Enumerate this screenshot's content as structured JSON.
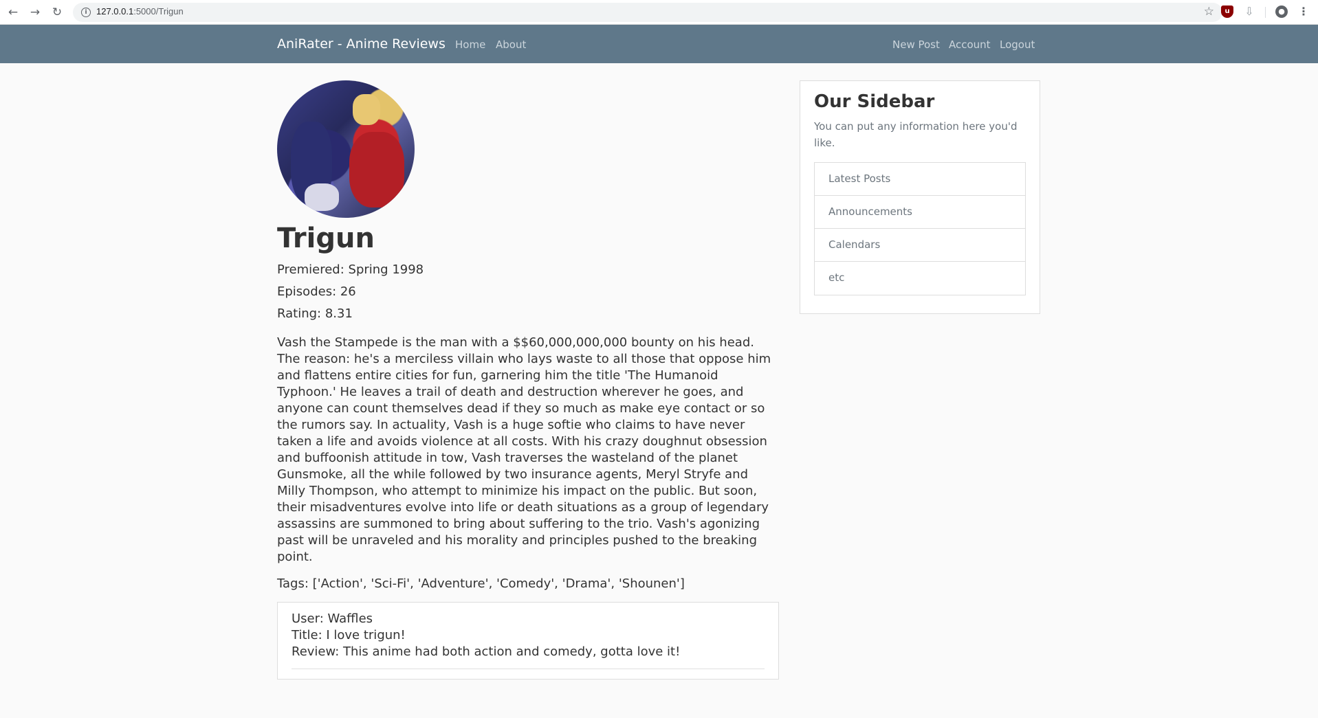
{
  "browser": {
    "url_host": "127.0.0.1",
    "url_rest": ":5000/Trigun",
    "back_icon": "←",
    "forward_icon": "→",
    "reload_icon": "↻",
    "info_icon": "i",
    "star_icon": "☆",
    "extension_icon": "u",
    "download_icon": "⇩",
    "account_icon": "●",
    "menu_icon": "⋮"
  },
  "navbar": {
    "brand": "AniRater - Anime Reviews",
    "left_links": [
      "Home",
      "About"
    ],
    "right_links": [
      "New Post",
      "Account",
      "Logout"
    ]
  },
  "anime": {
    "title": "Trigun",
    "premiered": "Premiered: Spring 1998",
    "episodes": "Episodes: 26",
    "rating": "Rating: 8.31",
    "synopsis": "Vash the Stampede is the man with a $$60,000,000,000 bounty on his head. The reason: he's a merciless villain who lays waste to all those that oppose him and flattens entire cities for fun, garnering him the title 'The Humanoid Typhoon.' He leaves a trail of death and destruction wherever he goes, and anyone can count themselves dead if they so much as make eye contact or so the rumors say. In actuality, Vash is a huge softie who claims to have never taken a life and avoids violence at all costs. With his crazy doughnut obsession and buffoonish attitude in tow, Vash traverses the wasteland of the planet Gunsmoke, all the while followed by two insurance agents, Meryl Stryfe and Milly Thompson, who attempt to minimize his impact on the public. But soon, their misadventures evolve into life or death situations as a group of legendary assassins are summoned to bring about suffering to the trio. Vash's agonizing past will be unraveled and his morality and principles pushed to the breaking point.",
    "tags": "Tags: ['Action', 'Sci-Fi', 'Adventure', 'Comedy', 'Drama', 'Shounen']"
  },
  "review": {
    "user": "User: Waffles",
    "title": "Title: I love trigun!",
    "body": "Review: This anime had both action and comedy, gotta love it!"
  },
  "sidebar": {
    "title": "Our Sidebar",
    "text": "You can put any information here you'd like.",
    "items": [
      "Latest Posts",
      "Announcements",
      "Calendars",
      "etc"
    ]
  },
  "colors": {
    "navbar_bg": "#5f788a",
    "page_bg": "#fafafa"
  }
}
